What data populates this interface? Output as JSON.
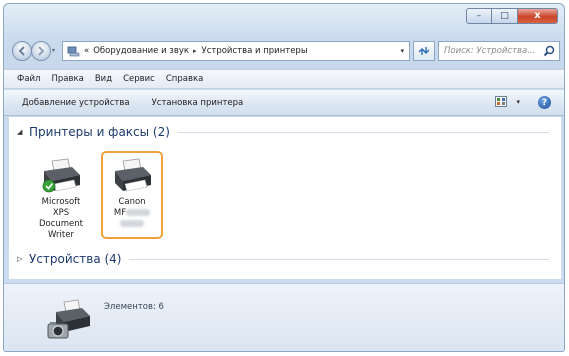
{
  "window": {
    "caption_buttons": {
      "minimize": "–",
      "maximize": "□",
      "close": "x"
    }
  },
  "address_bar": {
    "prefix": "«",
    "crumbs": [
      "Оборудование и звук",
      "Устройства и принтеры"
    ],
    "separator": "▸",
    "dropdown": "▾",
    "refresh_icon": "refresh-icon",
    "search_placeholder": "Поиск: Устройства..."
  },
  "menu": {
    "items": [
      "Файл",
      "Правка",
      "Вид",
      "Сервис",
      "Справка"
    ]
  },
  "toolbar": {
    "add_device": "Добавление устройства",
    "add_printer": "Установка принтера",
    "view_dropdown": "▾",
    "help": "?"
  },
  "groups": {
    "printers": {
      "title": "Принтеры и факсы (2)",
      "expanded": true
    },
    "devices": {
      "title": "Устройства (4)",
      "expanded": false
    }
  },
  "printers": [
    {
      "label_lines": [
        "Microsoft",
        "XPS",
        "Document",
        "Writer"
      ],
      "default": true,
      "selected": false
    },
    {
      "label_lines": [
        "Canon",
        "MF"
      ],
      "default": false,
      "selected": true
    }
  ],
  "details": {
    "items_count": "Элементов: 6"
  },
  "colors": {
    "selection_border": "#f0a040",
    "group_title": "#1e3a6e",
    "close_button": "#c9452c"
  }
}
